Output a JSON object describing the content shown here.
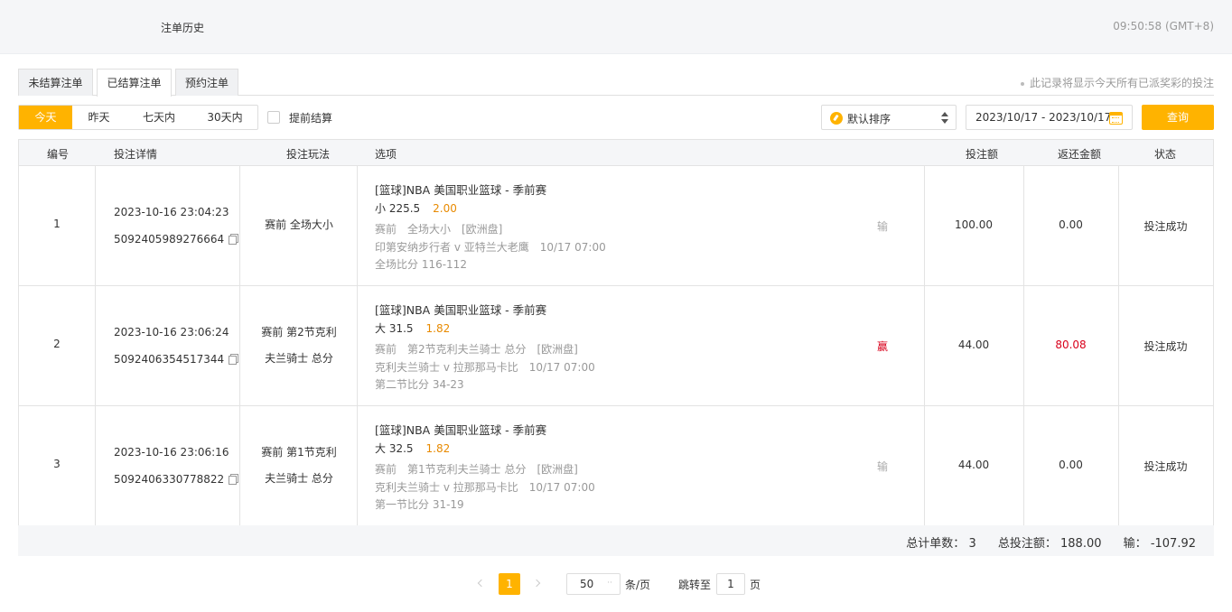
{
  "header": {
    "title": "注单历史",
    "clock": "09:50:58 (GMT+8)"
  },
  "tabs": [
    {
      "label": "未结算注单"
    },
    {
      "label": "已结算注单"
    },
    {
      "label": "预约注单"
    }
  ],
  "notice": "此记录将显示今天所有已派奖彩的投注",
  "day_filters": [
    {
      "label": "今天"
    },
    {
      "label": "昨天"
    },
    {
      "label": "七天内"
    },
    {
      "label": "30天内"
    }
  ],
  "early_settle_label": "提前结算",
  "sort": {
    "selected": "默认排序"
  },
  "date_range": "2023/10/17 - 2023/10/17",
  "query_label": "查询",
  "columns": {
    "no": "编号",
    "detail": "投注详情",
    "play": "投注玩法",
    "option": "选项",
    "amount": "投注额",
    "return": "返还金额",
    "status": "状态"
  },
  "rows": [
    {
      "no": "1",
      "time": "2023-10-16 23:04:23",
      "id": "5092405989276664",
      "play_line1": "赛前 全场大小",
      "play_line2": "",
      "league": "[篮球]NBA 美国职业篮球 - 季前赛",
      "pick": "小 225.5",
      "odds": "2.00",
      "market": "赛前　全场大小　[欧洲盘]",
      "match": "印第安纳步行者 v 亚特兰大老鹰　10/17 07:00",
      "score": "全场比分 116-112",
      "result": "输",
      "amount": "100.00",
      "return": "0.00",
      "status": "投注成功"
    },
    {
      "no": "2",
      "time": "2023-10-16 23:06:24",
      "id": "5092406354517344",
      "play_line1": "赛前 第2节克利",
      "play_line2": "夫兰骑士 总分",
      "league": "[篮球]NBA 美国职业篮球 - 季前赛",
      "pick": "大 31.5",
      "odds": "1.82",
      "market": "赛前　第2节克利夫兰骑士 总分　[欧洲盘]",
      "match": "克利夫兰骑士 v 拉那那马卡比　10/17 07:00",
      "score": "第二节比分 34-23",
      "result": "赢",
      "amount": "44.00",
      "return": "80.08",
      "status": "投注成功"
    },
    {
      "no": "3",
      "time": "2023-10-16 23:06:16",
      "id": "5092406330778822",
      "play_line1": "赛前 第1节克利",
      "play_line2": "夫兰骑士 总分",
      "league": "[篮球]NBA 美国职业篮球 - 季前赛",
      "pick": "大 32.5",
      "odds": "1.82",
      "market": "赛前　第1节克利夫兰骑士 总分　[欧洲盘]",
      "match": "克利夫兰骑士 v 拉那那马卡比　10/17 07:00",
      "score": "第一节比分 31-19",
      "result": "输",
      "amount": "44.00",
      "return": "0.00",
      "status": "投注成功"
    }
  ],
  "summary": {
    "count_label": "总计单数：",
    "count": "3",
    "total_label": "总投注额：",
    "total": "188.00",
    "net_label": "输：",
    "net": "-107.92"
  },
  "pagination": {
    "current": "1",
    "page_size": "50",
    "unit": "条/页",
    "jump_label": "跳转至",
    "jump_value": "1",
    "page_label": "页"
  },
  "colors": {
    "accent": "#ffb300",
    "odds": "#e88a00",
    "win": "#d9001b"
  }
}
